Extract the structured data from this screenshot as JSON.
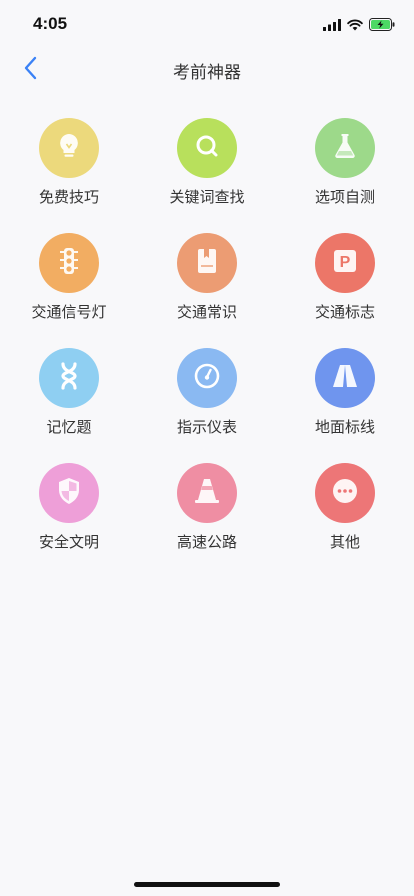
{
  "status_bar": {
    "time": "4:05"
  },
  "nav": {
    "title": "考前神器"
  },
  "items": [
    {
      "label": "免费技巧",
      "icon": "lightbulb-icon",
      "color": "#ecd97c"
    },
    {
      "label": "关键词查找",
      "icon": "search-icon",
      "color": "#b8e05c"
    },
    {
      "label": "选项自测",
      "icon": "flask-icon",
      "color": "#9dd98a"
    },
    {
      "label": "交通信号灯",
      "icon": "traffic-light-icon",
      "color": "#f2ad62"
    },
    {
      "label": "交通常识",
      "icon": "book-icon",
      "color": "#ec9c73"
    },
    {
      "label": "交通标志",
      "icon": "parking-sign-icon",
      "color": "#ec7668"
    },
    {
      "label": "记忆题",
      "icon": "dna-icon",
      "color": "#8fcff2"
    },
    {
      "label": "指示仪表",
      "icon": "gauge-icon",
      "color": "#8ab9f2"
    },
    {
      "label": "地面标线",
      "icon": "road-icon",
      "color": "#6f95ee"
    },
    {
      "label": "安全文明",
      "icon": "shield-icon",
      "color": "#ee9fd8"
    },
    {
      "label": "高速公路",
      "icon": "traffic-cone-icon",
      "color": "#ef8ea3"
    },
    {
      "label": "其他",
      "icon": "more-icon",
      "color": "#ed7677"
    }
  ]
}
